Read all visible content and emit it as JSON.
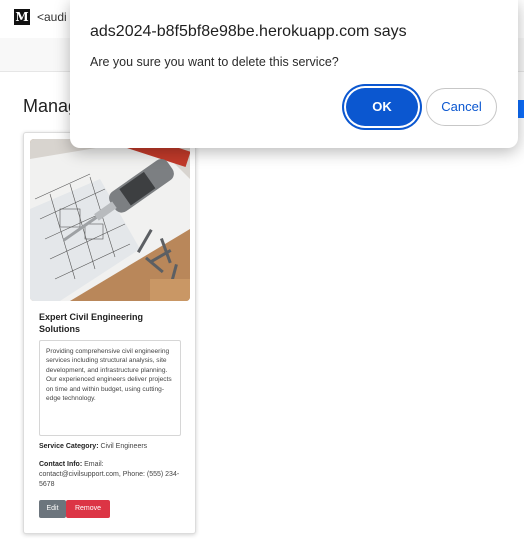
{
  "browser": {
    "tab_title": "<audi",
    "favicon_letter": "M"
  },
  "page": {
    "heading": "Manag"
  },
  "service_card": {
    "title": "Expert Civil Engineering Solutions",
    "description": "Providing comprehensive civil engineering services including structural analysis, site development, and infrastructure planning. Our experienced engineers deliver projects on time and within budget, using cutting-edge technology.",
    "category_label": "Service Category:",
    "category_value": "Civil Engineers",
    "contact_label": "Contact Info:",
    "contact_value": "Email: contact@civilsupport.com, Phone: (555) 234-5678",
    "edit_label": "Edit",
    "remove_label": "Remove",
    "image_icon": "construction-drill-blueprint-image"
  },
  "dialog": {
    "title": "ads2024-b8f5bf8e98be.herokuapp.com says",
    "message": "Are you sure you want to delete this service?",
    "ok_label": "OK",
    "cancel_label": "Cancel"
  },
  "colors": {
    "primary_button": "#0b57d0",
    "edit_button": "#6c757d",
    "remove_button": "#dc3545"
  }
}
